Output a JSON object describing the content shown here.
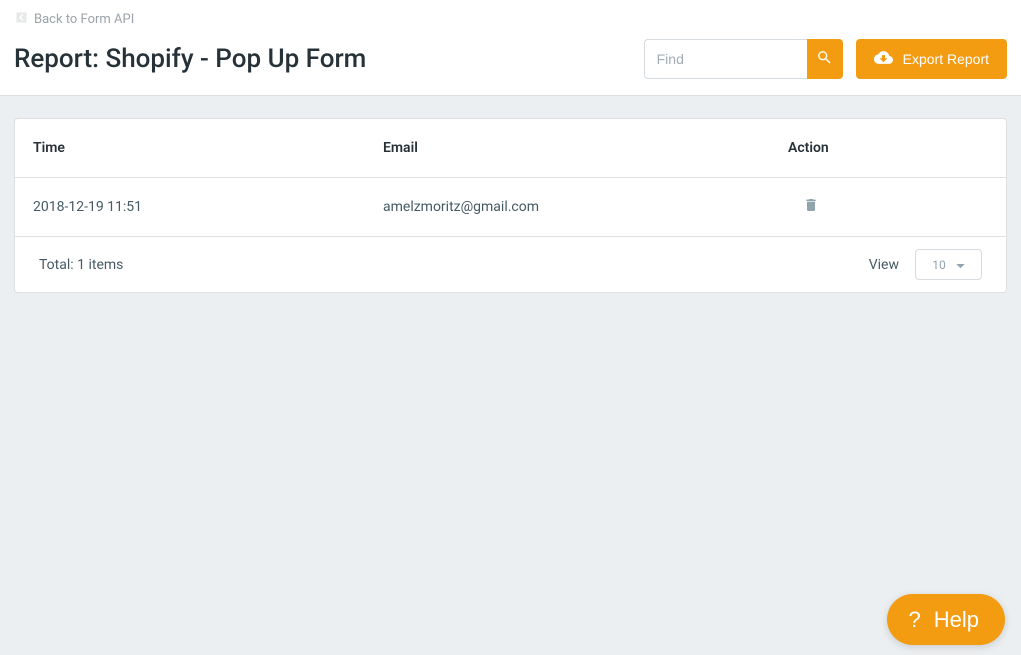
{
  "header": {
    "back_label": "Back to Form API",
    "page_title": "Report: Shopify - Pop Up Form",
    "search_placeholder": "Find",
    "export_label": "Export Report"
  },
  "table": {
    "columns": {
      "time": "Time",
      "email": "Email",
      "action": "Action"
    },
    "rows": [
      {
        "time": "2018-12-19 11:51",
        "email": "amelzmoritz@gmail.com"
      }
    ],
    "footer": {
      "total_label": "Total: 1 items",
      "view_label": "View",
      "page_size": "10"
    }
  },
  "help": {
    "label": "Help",
    "icon": "?"
  }
}
